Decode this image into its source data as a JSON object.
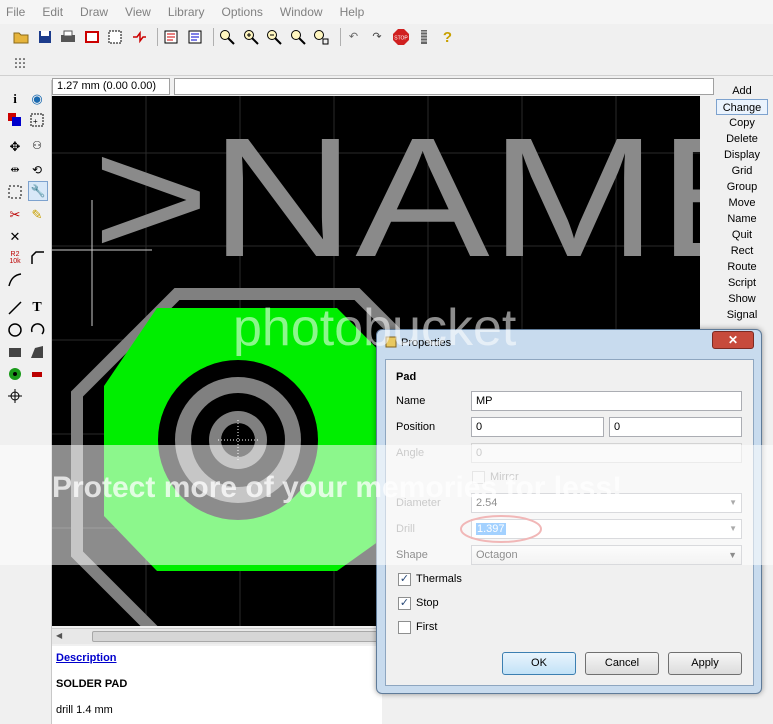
{
  "menu": [
    "File",
    "Edit",
    "Draw",
    "View",
    "Library",
    "Options",
    "Window",
    "Help"
  ],
  "toolbar_icons": [
    "open-icon",
    "save-icon",
    "print-icon",
    "cam-icon",
    "board-icon",
    "schematic-icon",
    "script-icon",
    "ulp-icon",
    "zoom-fit-icon",
    "zoom-in-icon",
    "zoom-out-icon",
    "zoom-redraw-icon",
    "zoom-select-icon",
    "undo-icon",
    "redo-icon",
    "stop-icon",
    "go-icon",
    "help-icon"
  ],
  "coord_display": "1.27 mm (0.00 0.00)",
  "canvas": {
    "name_text": ">NAME",
    "pad_color": "#00ff00",
    "outline_color": "#808080"
  },
  "commands": [
    "Add",
    "Change",
    "Copy",
    "Delete",
    "Display",
    "Grid",
    "Group",
    "Move",
    "Name",
    "Quit",
    "Rect",
    "Route",
    "Script",
    "Show",
    "Signal"
  ],
  "selected_command": "Change",
  "description": {
    "link": "Description",
    "title": "SOLDER PAD",
    "detail": "drill 1.4 mm"
  },
  "watermark": {
    "brand": "photobucket",
    "tagline": "Protect more of your memories for less!"
  },
  "dialog": {
    "title": "Properties",
    "close": "✕",
    "section": "Pad",
    "name_label": "Name",
    "name_value": "MP",
    "position_label": "Position",
    "position_x": "0",
    "position_y": "0",
    "angle_label": "Angle",
    "angle_value": "0",
    "mirror_label": "Mirror",
    "diameter_label": "Diameter",
    "diameter_value": "2.54",
    "drill_label": "Drill",
    "drill_value": "1.397",
    "shape_label": "Shape",
    "shape_value": "Octagon",
    "thermals_label": "Thermals",
    "thermals_checked": true,
    "stop_label": "Stop",
    "stop_checked": true,
    "first_label": "First",
    "first_checked": false,
    "ok": "OK",
    "cancel": "Cancel",
    "apply": "Apply",
    "highlight_color": "#e06060"
  }
}
